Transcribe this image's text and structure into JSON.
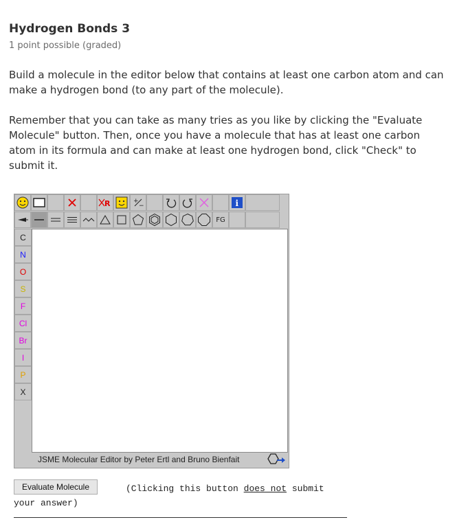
{
  "problem": {
    "title": "Hydrogen Bonds 3",
    "subtitle": "1 point possible (graded)",
    "paragraph1": "Build a molecule in the editor below that contains at least one carbon atom and can make a hydrogen bond (to any part of the molecule).",
    "paragraph2": "Remember that you can take as many tries as you like by clicking the \"Evaluate Molecule\" button. Then, once you have a molecule that has at least one carbon atom in its formula and can make at least one hydrogen bond, click \"Check\" to submit it."
  },
  "editor": {
    "toolbar_fg_label": "FG",
    "elements": [
      "C",
      "N",
      "O",
      "S",
      "F",
      "Cl",
      "Br",
      "I",
      "P",
      "X"
    ],
    "element_colors": [
      "#222222",
      "#1a1aff",
      "#e00000",
      "#c8b400",
      "#e000e0",
      "#e000e0",
      "#e000e0",
      "#e000e0",
      "#e0a000",
      "#222222"
    ],
    "credit": "JSME Molecular Editor by Peter Ertl and Bruno Bienfait",
    "info_label": "i"
  },
  "actions": {
    "evaluate_label": "Evaluate Molecule",
    "note_pre": "(Clicking this button ",
    "note_underlined": "does not",
    "note_post": " submit your answer)"
  }
}
